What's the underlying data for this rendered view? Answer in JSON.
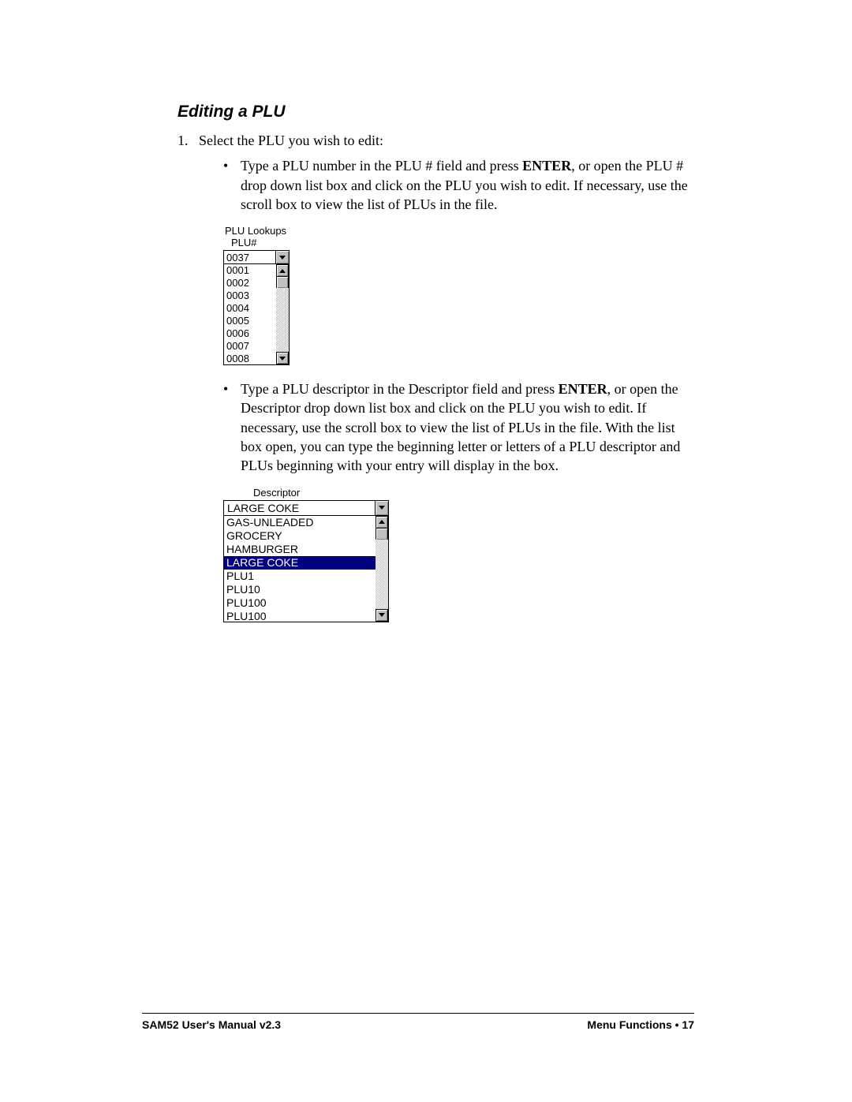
{
  "heading": "Editing a PLU",
  "step_number": "1.",
  "step_text": "Select the PLU you wish to edit:",
  "bullet1_a": "Type a PLU number in the PLU # field and press ",
  "bullet1_b": "ENTER",
  "bullet1_c": ", or open the PLU # drop down list box and click on the PLU you wish to edit.  If necessary, use the scroll box to view the list of PLUs in the file.",
  "plu": {
    "title1": "PLU Lookups",
    "title2": "PLU#",
    "value": "0037",
    "options": [
      "0001",
      "0002",
      "0003",
      "0004",
      "0005",
      "0006",
      "0007",
      "0008"
    ]
  },
  "bullet2_a": "Type a PLU descriptor in the Descriptor field and press ",
  "bullet2_b": "ENTER",
  "bullet2_c": ", or open the Descriptor drop down list box and click on the PLU you wish to edit.  If necessary, use the scroll box to view the list of PLUs in the file.  With the list box open, you can type the beginning letter or letters of a PLU descriptor and PLUs beginning with your entry will display in the box.",
  "desc": {
    "label": "Descriptor",
    "value": "LARGE COKE",
    "options": [
      "GAS-UNLEADED",
      "GROCERY",
      "HAMBURGER",
      "LARGE COKE",
      "PLU1",
      "PLU10",
      "PLU100",
      "PLU100"
    ],
    "selected_index": 3
  },
  "footer_left": "SAM52 User's Manual v2.3",
  "footer_right_a": "Menu Functions  ",
  "footer_right_b": "•",
  "footer_right_c": "  17"
}
